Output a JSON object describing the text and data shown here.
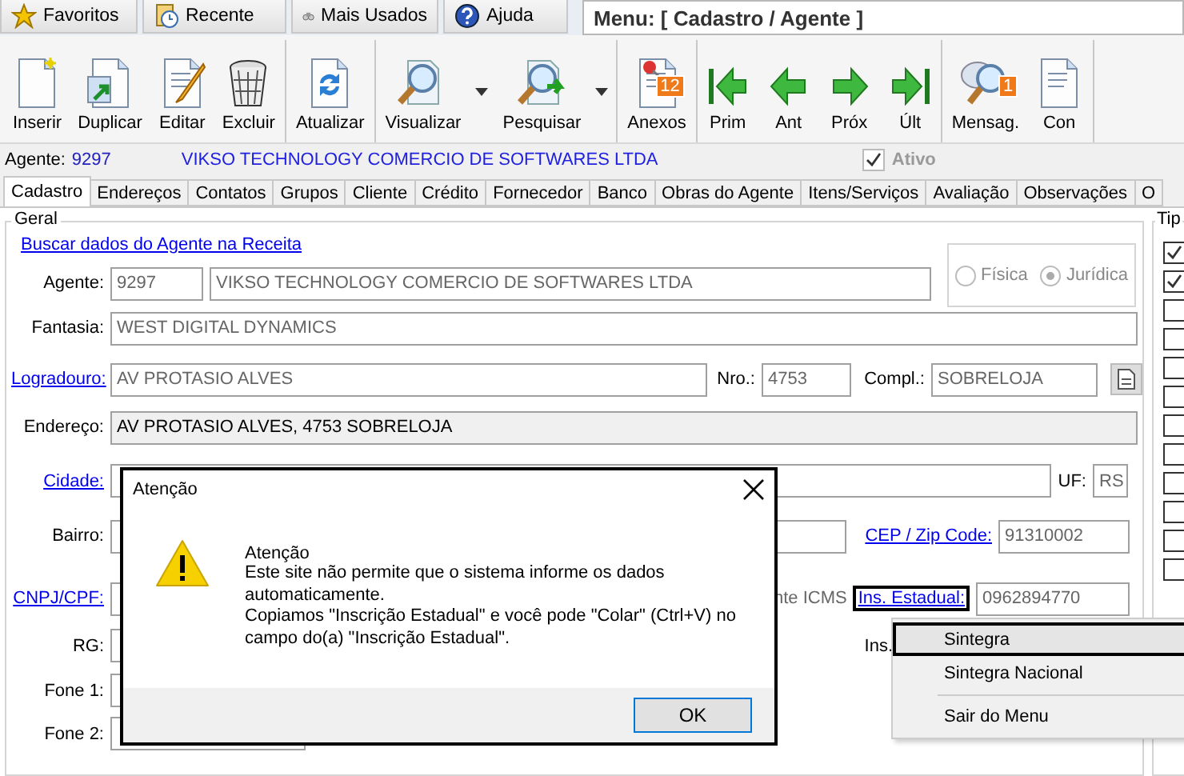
{
  "top_tabs": [
    {
      "label": "Favoritos"
    },
    {
      "label": "Recente"
    },
    {
      "label": "Mais Usados"
    },
    {
      "label": "Ajuda"
    }
  ],
  "menu_title": "Menu: [ Cadastro / Agente ]",
  "toolbar": [
    [
      {
        "label": "Inserir"
      },
      {
        "label": "Duplicar"
      },
      {
        "label": "Editar"
      },
      {
        "label": "Excluir"
      }
    ],
    [
      {
        "label": "Atualizar"
      }
    ],
    [
      {
        "label": "Visualizar",
        "dropdown": true
      },
      {
        "label": "Pesquisar",
        "dropdown": true
      }
    ],
    [
      {
        "label": "Anexos",
        "badge": "12"
      }
    ],
    [
      {
        "label": "Prim"
      },
      {
        "label": "Ant"
      },
      {
        "label": "Próx"
      },
      {
        "label": "Últ"
      }
    ],
    [
      {
        "label": "Mensag.",
        "badge": "1"
      },
      {
        "label": "Con"
      }
    ]
  ],
  "agent_bar": {
    "label": "Agente:",
    "code": "9297",
    "name": "VIKSO TECHNOLOGY COMERCIO DE SOFTWARES LTDA",
    "active": {
      "label": "Ativo",
      "checked": true,
      "disabled": true
    }
  },
  "tabs": [
    {
      "label": "Cadastro",
      "selected": true
    },
    {
      "label": "Endereços",
      "selected": false
    },
    {
      "label": "Contatos",
      "selected": false
    },
    {
      "label": "Grupos",
      "selected": false
    },
    {
      "label": "Cliente",
      "selected": false
    },
    {
      "label": "Crédito",
      "selected": false
    },
    {
      "label": "Fornecedor",
      "selected": false
    },
    {
      "label": "Banco",
      "selected": false
    },
    {
      "label": "Obras do Agente",
      "selected": false
    },
    {
      "label": "Itens/Serviços",
      "selected": false
    },
    {
      "label": "Avaliação",
      "selected": false
    },
    {
      "label": "Observações",
      "selected": false
    },
    {
      "label": "O",
      "selected": false
    }
  ],
  "geral": {
    "legend": "Geral",
    "search_link": "Buscar dados do Agente na Receita",
    "agente": {
      "label": "Agente:",
      "code": "9297",
      "name": "VIKSO TECHNOLOGY COMERCIO DE SOFTWARES LTDA"
    },
    "person_type": [
      {
        "label": "Física",
        "selected": false
      },
      {
        "label": "Jurídica",
        "selected": true
      }
    ],
    "fantasia": {
      "label": "Fantasia:",
      "value": "WEST DIGITAL DYNAMICS"
    },
    "logradouro": {
      "label": "Logradouro:",
      "value": "AV PROTASIO ALVES"
    },
    "nro": {
      "label": "Nro.:",
      "value": "4753"
    },
    "compl": {
      "label": "Compl.:",
      "value": "SOBRELOJA"
    },
    "endereco": {
      "label": "Endereço:",
      "value": "AV PROTASIO ALVES, 4753 SOBRELOJA"
    },
    "cidade": {
      "label": "Cidade:"
    },
    "uf": {
      "label": "UF:",
      "value": "RS"
    },
    "bairro": {
      "label": "Bairro:"
    },
    "cep": {
      "label": "CEP / Zip Code:",
      "value": "91310002"
    },
    "cnpj": {
      "label": "CNPJ/CPF:"
    },
    "icms_label": "nte ICMS",
    "ins_estadual": {
      "label": "Ins. Estadual:",
      "value": "0962894770"
    },
    "rg": {
      "label": "RG:"
    },
    "ins_label": "Ins.",
    "fone1": {
      "label": "Fone 1:"
    },
    "fone2": {
      "label": "Fone 2:"
    }
  },
  "tipo": {
    "label": "Tip",
    "checkboxes": [
      {
        "checked": true
      },
      {
        "checked": true
      },
      {
        "checked": false
      },
      {
        "checked": false
      },
      {
        "checked": false
      },
      {
        "checked": false
      },
      {
        "checked": false
      },
      {
        "checked": false
      },
      {
        "checked": false
      },
      {
        "checked": false
      },
      {
        "checked": false
      },
      {
        "checked": false
      }
    ]
  },
  "dialog": {
    "title": "Atenção",
    "heading": "Atenção",
    "message": "Este site não permite que o sistema informe os dados\nautomaticamente.\nCopiamos \"Inscrição Estadual\" e você pode \"Colar\" (Ctrl+V) no\ncampo do(a) \"Inscrição Estadual\".",
    "button": "OK"
  },
  "context_menu": [
    {
      "label": "Sintegra",
      "selected": true,
      "divider_before": false
    },
    {
      "label": "Sintegra Nacional",
      "selected": false,
      "divider_before": false
    },
    {
      "label": "Sair do Menu",
      "selected": false,
      "divider_before": true
    }
  ]
}
